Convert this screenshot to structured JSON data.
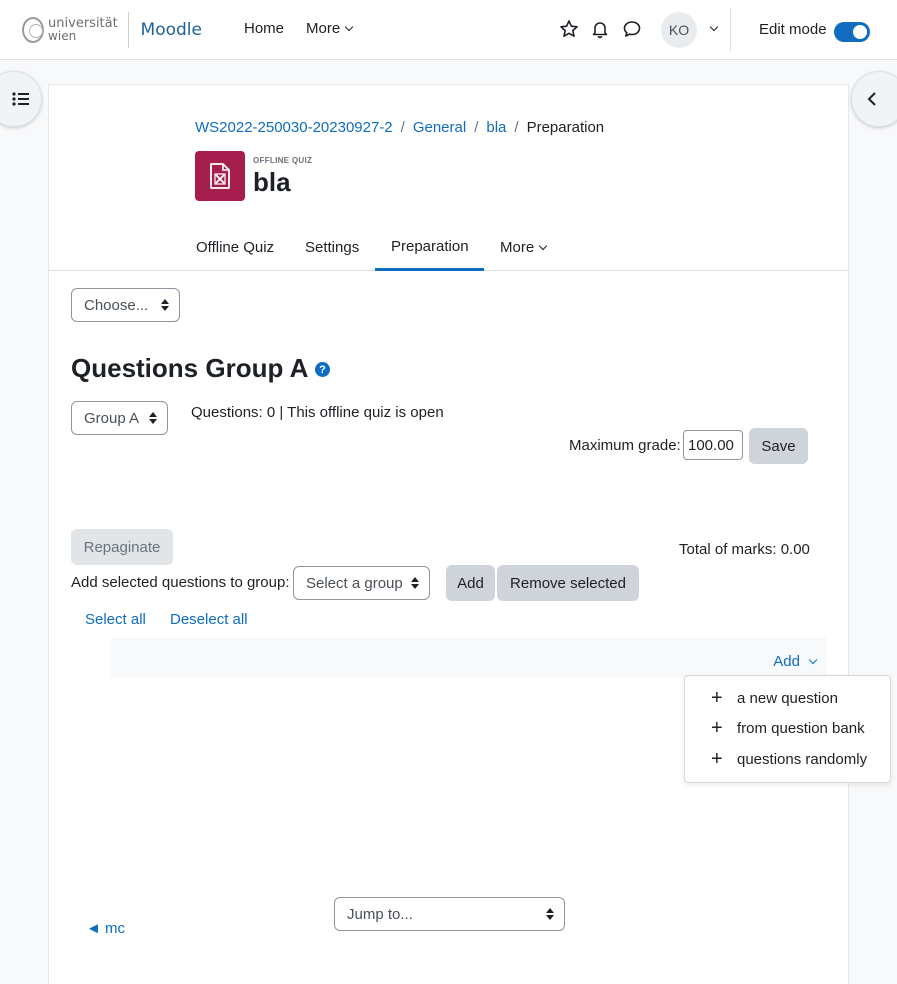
{
  "header": {
    "logo_line1": "universität",
    "logo_line2": "wien",
    "app_name": "Moodle",
    "nav": [
      "Home",
      "More"
    ],
    "avatar_initials": "KO",
    "edit_mode_label": "Edit mode",
    "edit_mode_on": true
  },
  "breadcrumb": [
    "WS2022-250030-20230927-2",
    "General",
    "bla",
    "Preparation"
  ],
  "module": {
    "type_label": "OFFLINE QUIZ",
    "title": "bla"
  },
  "tabs": [
    "Offline Quiz",
    "Settings",
    "Preparation",
    "More"
  ],
  "active_tab": "Preparation",
  "choose_select": "Choose...",
  "heading": "Questions Group A",
  "help_icon": "?",
  "group_select": "Group A",
  "questions_status": "Questions: 0 | This offline quiz is open",
  "max_grade_label": "Maximum grade:",
  "max_grade_value": "100.00",
  "save_button": "Save",
  "repaginate_button": "Repaginate",
  "total_marks": "Total of marks: 0.00",
  "add_to_group_label": "Add selected questions to group:",
  "group_target_select": "Select a group",
  "add_button": "Add",
  "remove_selected_button": "Remove selected",
  "select_all": "Select all",
  "deselect_all": "Deselect all",
  "add_menu": {
    "toggle_label": "Add",
    "items": [
      "a new question",
      "from question bank",
      "questions randomly"
    ]
  },
  "jump_select": "Jump to...",
  "prev_link": "◄ mc",
  "colors": {
    "accent": "#0f6cbf",
    "module_icon": "#a61e4d"
  }
}
